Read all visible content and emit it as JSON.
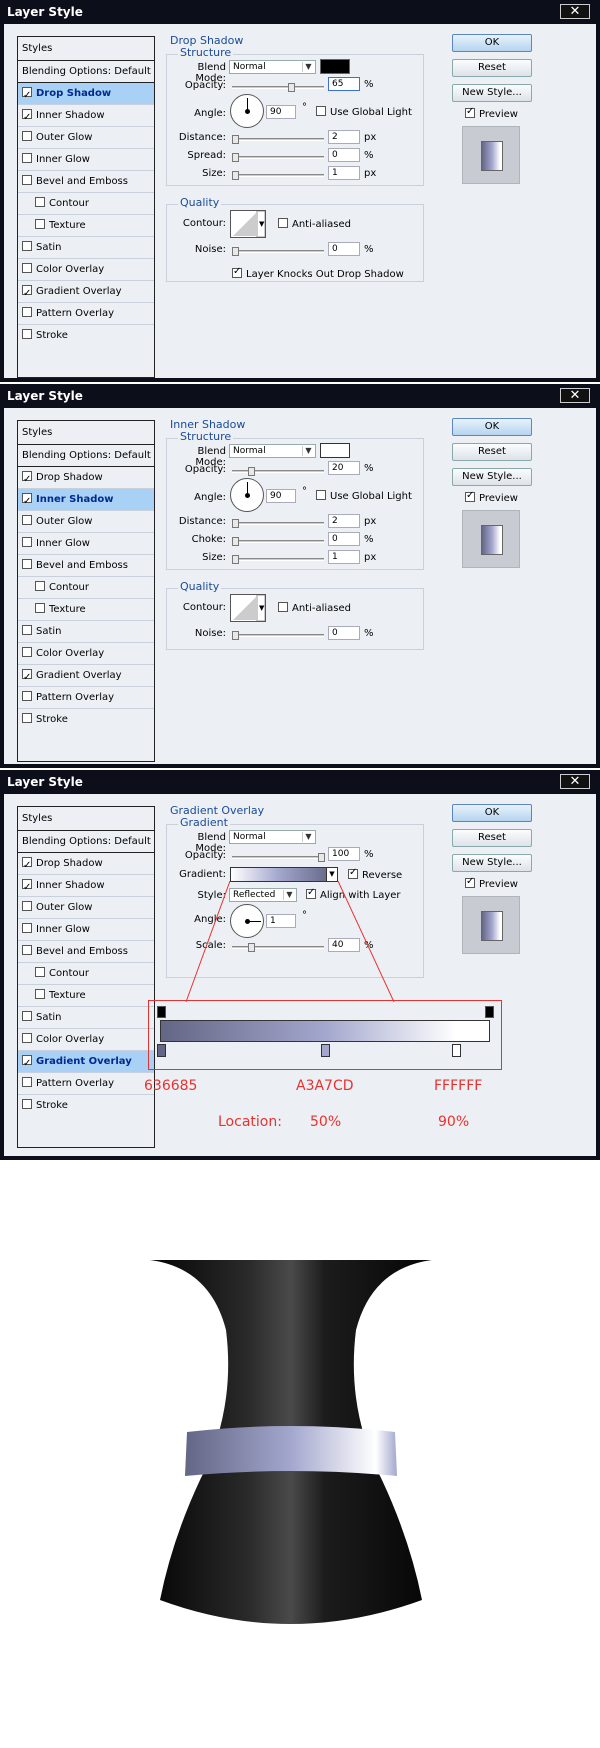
{
  "dialogs": [
    {
      "title": "Layer Style",
      "panel": "Drop Shadow",
      "sub": "Structure",
      "blend_label": "Blend Mode:",
      "blend_value": "Normal",
      "opacity_label": "Opacity:",
      "opacity": "65",
      "angle_label": "Angle:",
      "angle": "90",
      "global_light": "Use Global Light",
      "distance_label": "Distance:",
      "distance": "2",
      "spread_label": "Spread:",
      "spread": "0",
      "size_label": "Size:",
      "size": "1",
      "quality": "Quality",
      "contour_label": "Contour:",
      "antialias": "Anti-aliased",
      "noise_label": "Noise:",
      "noise": "0",
      "knockout": "Layer Knocks Out Drop Shadow"
    },
    {
      "title": "Layer Style",
      "panel": "Inner Shadow",
      "sub": "Structure",
      "blend_label": "Blend Mode:",
      "blend_value": "Normal",
      "opacity_label": "Opacity:",
      "opacity": "20",
      "angle_label": "Angle:",
      "angle": "90",
      "global_light": "Use Global Light",
      "distance_label": "Distance:",
      "distance": "2",
      "spread_label": "Choke:",
      "spread": "0",
      "size_label": "Size:",
      "size": "1",
      "quality": "Quality",
      "contour_label": "Contour:",
      "antialias": "Anti-aliased",
      "noise_label": "Noise:",
      "noise": "0"
    },
    {
      "title": "Layer Style",
      "panel": "Gradient Overlay",
      "sub": "Gradient",
      "blend_label": "Blend Mode:",
      "blend_value": "Normal",
      "opacity_label": "Opacity:",
      "opacity": "100",
      "gradient_label": "Gradient:",
      "reverse": "Reverse",
      "style_label": "Style:",
      "style_value": "Reflected",
      "align": "Align with Layer",
      "angle_label": "Angle:",
      "angle": "1",
      "scale_label": "Scale:",
      "scale": "40"
    }
  ],
  "sidebar": [
    "Styles",
    "Blending Options: Default",
    "Drop Shadow",
    "Inner Shadow",
    "Outer Glow",
    "Inner Glow",
    "Bevel and Emboss",
    "Contour",
    "Texture",
    "Satin",
    "Color Overlay",
    "Gradient Overlay",
    "Pattern Overlay",
    "Stroke"
  ],
  "buttons": {
    "ok": "OK",
    "reset": "Reset",
    "new_style": "New Style...",
    "preview": "Preview",
    "close": "✕"
  },
  "units": {
    "pct": "%",
    "px": "px",
    "deg": "°"
  },
  "annotation": {
    "c1": "636685",
    "c2": "A3A7CD",
    "c3": "FFFFFF",
    "location_label": "Location:",
    "loc2": "50%",
    "loc3": "90%"
  },
  "colors": {
    "c1": "#636685",
    "c2": "#a3a7cd",
    "c3": "#ffffff",
    "accent": "#e8322f"
  }
}
